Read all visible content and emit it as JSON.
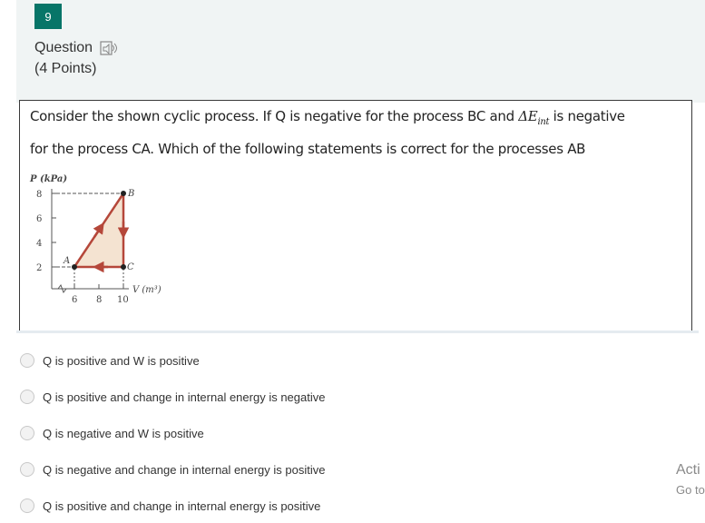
{
  "question": {
    "number": "9",
    "label": "Question",
    "points": "(4 Points)",
    "stem_line1_a": "Consider the shown cyclic process. If Q is negative for the process BC and ",
    "delta_e": "ΔE",
    "delta_e_sub": "int",
    "stem_line1_b": " is negative",
    "stem_line2": "for the process CA. Which of the following statements is correct for the processes AB"
  },
  "graph": {
    "y_axis_label": "P (kPa)",
    "x_axis_label": "V (m³)",
    "y_ticks": [
      "8",
      "6",
      "4",
      "2"
    ],
    "x_ticks": [
      "6",
      "8",
      "10"
    ],
    "point_labels": {
      "A": "A",
      "B": "B",
      "C": "C"
    }
  },
  "options": [
    {
      "label": "Q is positive and W is positive"
    },
    {
      "label": "Q is positive and change in internal energy is negative"
    },
    {
      "label": "Q is negative and W is positive"
    },
    {
      "label": "Q is negative and change in internal energy is positive"
    },
    {
      "label": "Q is positive and change in internal energy is positive"
    }
  ],
  "watermark": {
    "line1": "Acti",
    "line2": "Go to"
  },
  "colors": {
    "accent": "#077568",
    "triangle_fill": "#f4e3d1",
    "arrow": "#b5473a"
  }
}
